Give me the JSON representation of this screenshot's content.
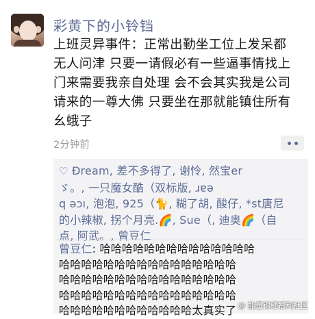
{
  "post": {
    "nickname": "彩黄下的小铃铛",
    "lines": [
      "上班灵异事件：正常出勤坐工位上发呆都",
      "无人问津 只要一请假必有一些逼事情找上",
      "门来需要我亲自处理 会不会其实我是公司",
      "请来的一尊大佛 只要坐在那就能镇住所有",
      "幺蛾子"
    ],
    "time": "2分钟前"
  },
  "likes": {
    "icon": "heart-icon",
    "lines": [
      "Đream, 差不多得了, 谢怜, 然宝er",
      "ゞ。, 一只魔女酷（双标版, ɹɐǝ",
      "q ǝɔı, 泡泡, 925（🐈, 糊了胡, 酸仔, *st唐尼",
      "的小辣椒, 拐个月亮.🌈, Sue（, 迪奥🌈（自",
      "点, 阿武。, 曾豆仁"
    ]
  },
  "comment": {
    "author": "曾豆仁",
    "separator": ": ",
    "lines": [
      "哈哈哈哈哈哈哈哈哈哈哈哈哈哈",
      "哈哈哈哈哈哈哈哈哈哈哈哈哈哈哈哈",
      "哈哈哈哈哈哈哈哈哈哈哈哈哈哈哈哈",
      "哈哈哈哈哈哈哈哈哈哈哈哈哈哈哈哈",
      "哈哈哈哈哈哈哈哈哈哈哈哈太真实了"
    ]
  },
  "watermark": "@ 能量锦鲤福利社区",
  "colors": {
    "accent": "#5c6c96",
    "panel": "#f3f3f5",
    "time": "#9b9b9b"
  }
}
